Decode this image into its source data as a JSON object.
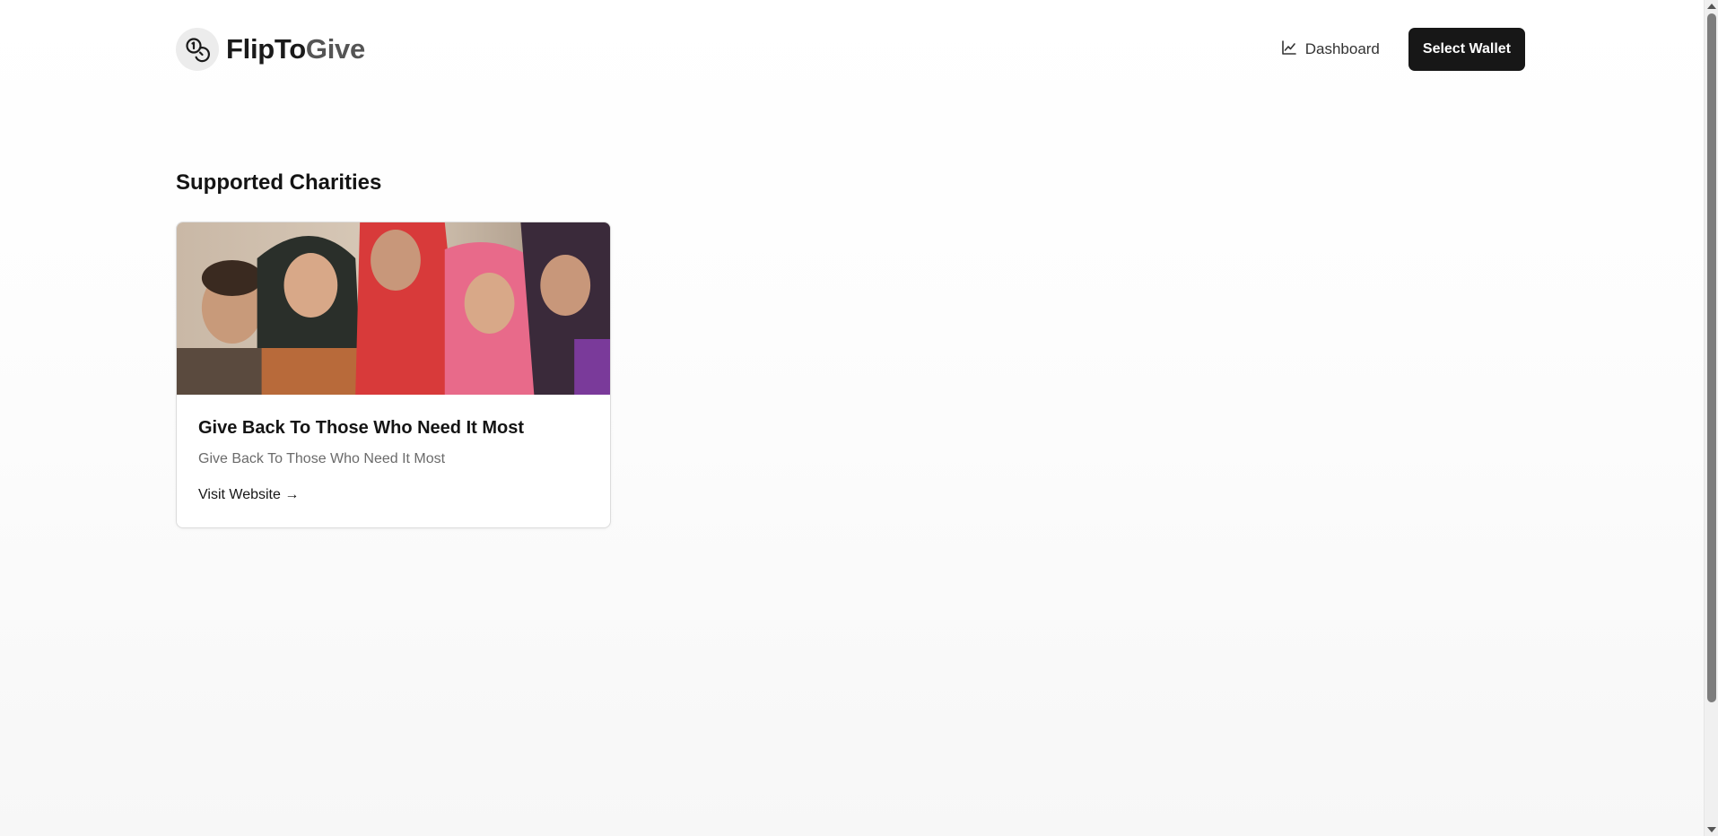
{
  "brand": {
    "name_part1": "FlipTo",
    "name_part2": "Give",
    "logo_icon": "coins-icon"
  },
  "nav": {
    "dashboard_label": "Dashboard",
    "dashboard_icon": "line-chart-icon",
    "wallet_button_label": "Select Wallet"
  },
  "main": {
    "section_title": "Supported Charities",
    "charities": [
      {
        "title": "Give Back To Those Who Need It Most",
        "description": "Give Back To Those Who Need It Most",
        "link_label": "Visit Website →"
      }
    ]
  },
  "colors": {
    "primary_button": "#171717",
    "background": "#ffffff",
    "muted_text": "#6b6b6b"
  }
}
